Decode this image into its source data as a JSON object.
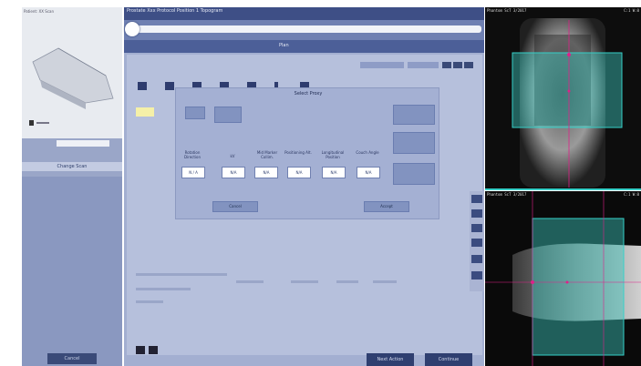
{
  "left_panel": {
    "header_text": "Patient: XX  Scan",
    "mid_button": "Change Scan",
    "bottom_button": "Cancel"
  },
  "top": {
    "title": "Prostate Xxx Protocol Position 1 Topogram",
    "tab_label": "Plan"
  },
  "toolbar_icons": [
    "ref-icon",
    "mode-icon",
    "cam-icon",
    "gantry-icon",
    "couch-icon",
    "dose-icon",
    "lock-icon"
  ],
  "dialog": {
    "title": "Select Proxy",
    "values": [
      {
        "label": "Rotation Direction",
        "value": "N / A"
      },
      {
        "label": "kV",
        "value": "N/A"
      },
      {
        "label": "Mid Marker Collim.",
        "value": "N/A"
      },
      {
        "label": "Positioning Alt.",
        "value": "N/A"
      },
      {
        "label": "Longitudinal Position",
        "value": "N/A"
      },
      {
        "label": "Couch Angle",
        "value": "N/A"
      }
    ],
    "cancel": "Cancel",
    "accept": "Accept"
  },
  "side_tools_count": 6,
  "bottom": {
    "btn1": "Next Action",
    "btn2": "Continue"
  },
  "ct": {
    "top_tl": "Phantom  ScT  3/2017",
    "top_tr": "C:1  W:0",
    "bot_tl": "Phantom  ScT  3/2017",
    "bot_tr": "C:1  W:0",
    "accent": "#35d0c8",
    "line": "#e0208a"
  }
}
